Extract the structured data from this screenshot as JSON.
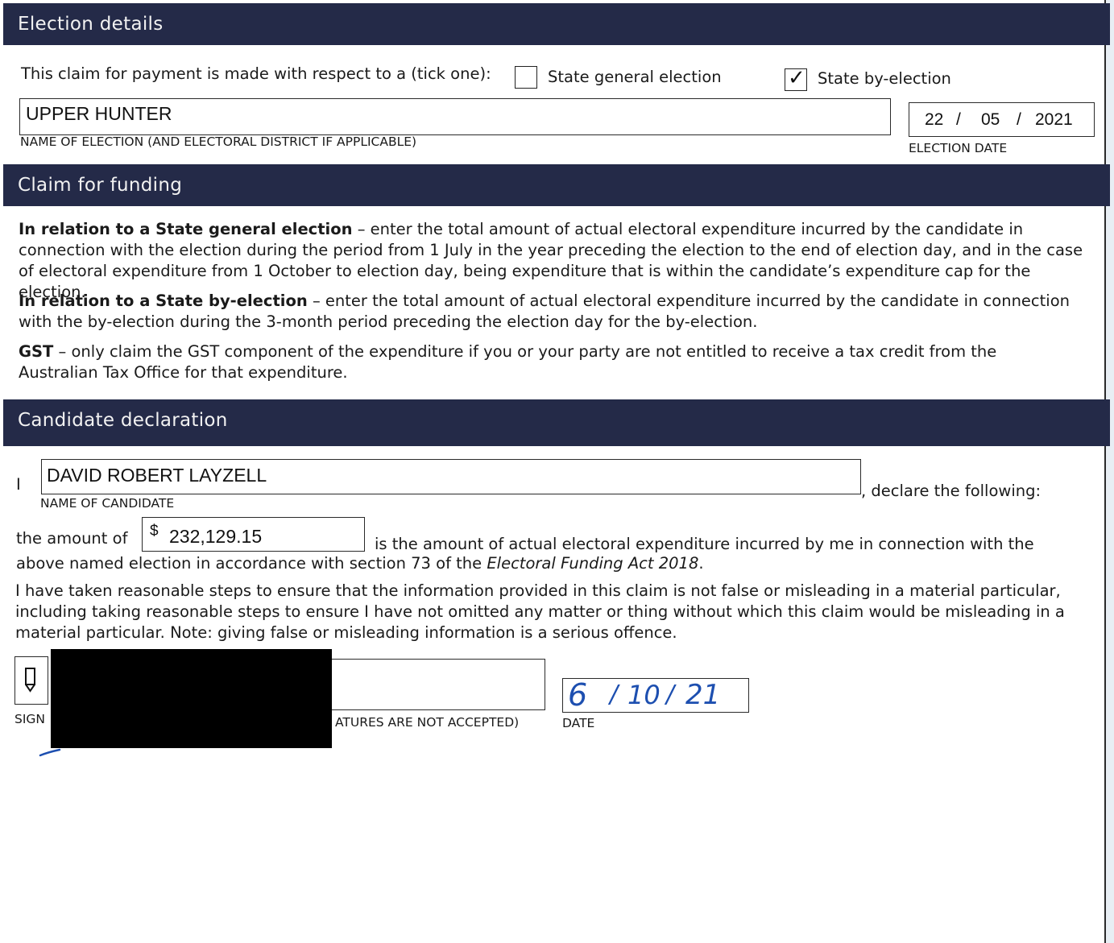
{
  "sections": {
    "election_details": "Election details",
    "claim_for_funding": "Claim for funding",
    "candidate_declaration": "Candidate declaration"
  },
  "election": {
    "prompt": "This claim for payment is made with respect to a (tick one):",
    "options": [
      {
        "label": "State general election",
        "checked": false
      },
      {
        "label": "State by-election",
        "checked": true
      }
    ],
    "name_value": "UPPER HUNTER",
    "name_caption": "NAME OF ELECTION (AND ELECTORAL DISTRICT IF APPLICABLE)",
    "date": {
      "day": "22",
      "month": "05",
      "year": "2021",
      "sep": "/"
    },
    "date_caption": "ELECTION DATE"
  },
  "claim": {
    "p1_bold": "In relation to a State general election",
    "p1_text": " – enter the total amount of actual electoral expenditure incurred by the candidate in connection with the election during the period from 1 July in the year preceding the election to the end of election day, and in the case of electoral expenditure from 1 October to election day, being expenditure that is within the candidate’s expenditure cap for the election.",
    "p2_bold": "In relation to a State by-election",
    "p2_text": " – enter the total amount of actual electoral expenditure incurred by the candidate in connection with the by-election during the 3-month period preceding the election day for the by-election.",
    "p3_bold": "GST",
    "p3_text": " – only claim the GST component of the expenditure if you or your party are not entitled to receive a tax credit from the Australian Tax Office for that expenditure."
  },
  "declaration": {
    "i_label": "I",
    "candidate_name": "DAVID ROBERT LAYZELL",
    "name_caption": "NAME OF CANDIDATE",
    "declare_suffix": ", declare the following:",
    "amount_prefix": "the amount of",
    "currency": "$",
    "amount": "232,129.15",
    "amount_text_1": "is the amount of actual electoral expenditure incurred by me in connection with the",
    "amount_text_2": "above named election in accordance with section 73 of the ",
    "act_name": "Electoral Funding Act 2018",
    "amount_text_end": ".",
    "steps_text": "I have taken reasonable steps to ensure that the information provided in this claim is not false or misleading in a material particular, including taking reasonable steps to ensure I have not omitted any matter or thing without which this claim would be misleading in a material particular. Note: giving false or misleading information is a serious offence.",
    "signature_caption_left": "SIGN",
    "signature_caption_right": "ATURES ARE NOT ACCEPTED)",
    "signed_date": {
      "day": "6",
      "month": "10",
      "year": "21",
      "sep": "/"
    },
    "date_caption": "DATE"
  },
  "colors": {
    "band": "#242a48",
    "ink_blue": "#1d4fb0"
  }
}
